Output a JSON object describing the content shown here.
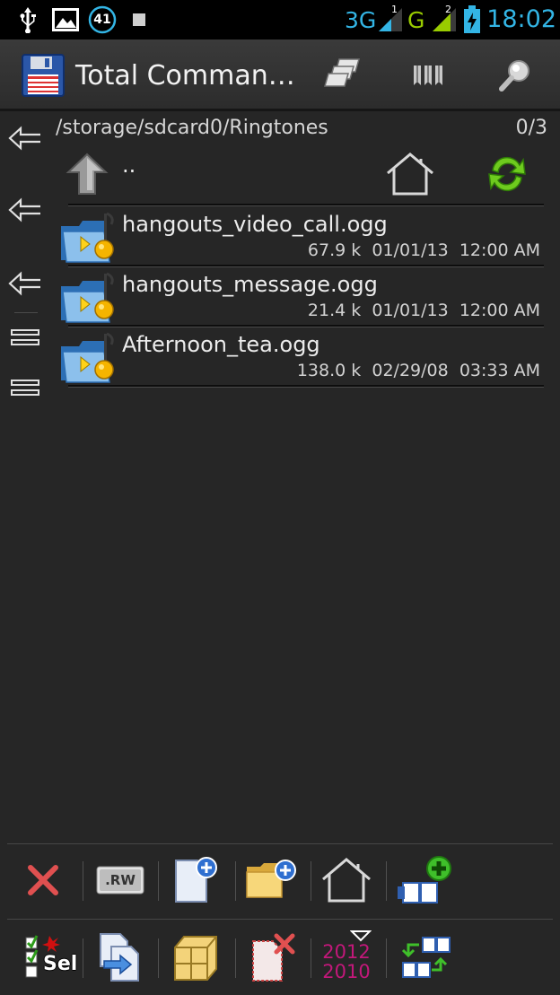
{
  "status_bar": {
    "notification_badge": "41",
    "network_3g": "3G",
    "network_g": "G",
    "signal_1_label": "1",
    "signal_2_label": "2",
    "time": "18:02"
  },
  "action_bar": {
    "title": "Total Comman…"
  },
  "path": {
    "current": "/storage/sdcard0/Ringtones",
    "count": "0/3",
    "parent": ".."
  },
  "files": [
    {
      "name": "hangouts_video_call.ogg",
      "size": "67.9 k",
      "date": "01/01/13",
      "time": "12:00 AM"
    },
    {
      "name": "hangouts_message.ogg",
      "size": "21.4 k",
      "date": "01/01/13",
      "time": "12:00 AM"
    },
    {
      "name": "Afternoon_tea.ogg",
      "size": "138.0 k",
      "date": "02/29/08",
      "time": "03:33 AM"
    }
  ],
  "toolbar_top": {
    "rw_label": ".RW"
  },
  "toolbar_bottom": {
    "sel_label": "Sel",
    "sort_year_top": "2012",
    "sort_year_bottom": "2010"
  },
  "colors": {
    "background": "#262626",
    "accent_blue": "#33b5e5",
    "signal_green": "#99cc00",
    "delete_red": "#e05050"
  }
}
